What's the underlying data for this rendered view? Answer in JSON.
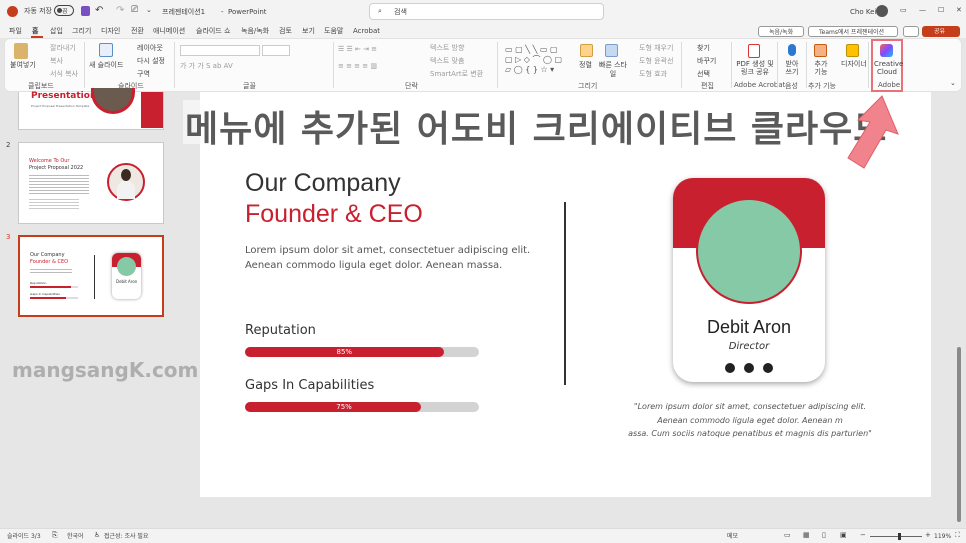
{
  "titlebar": {
    "autosave": "자동 저장",
    "toggle": "끔",
    "doc_title": "프레젠테이션1",
    "app": "PowerPoint",
    "search": "검색",
    "user": "Cho Kei"
  },
  "menu": {
    "tabs": [
      "파일",
      "홈",
      "삽입",
      "그리기",
      "디자인",
      "전환",
      "애니메이션",
      "슬라이드 쇼",
      "녹음/녹화",
      "검토",
      "보기",
      "도움말",
      "Acrobat"
    ],
    "active": "홈"
  },
  "top_right": {
    "record": "녹음/녹화",
    "teams": "Teams에서 프레젠테이션",
    "share": "공유"
  },
  "ribbon": {
    "clipboard": {
      "paste": "붙여넣기",
      "cut": "잘라내기",
      "copy": "복사",
      "format": "서식 복사",
      "label": "클립보드"
    },
    "slides": {
      "new": "새 슬라이드",
      "layout": "레이아웃",
      "reset": "다시 설정",
      "section": "구역",
      "label": "슬라이드"
    },
    "font": {
      "label": "글꼴"
    },
    "paragraph": {
      "text_dir": "텍스트 방향",
      "align": "텍스트 맞춤",
      "smartart": "SmartArt로 변환",
      "label": "단락"
    },
    "drawing": {
      "arrange": "정렬",
      "styles": "빠른 스타일",
      "fill": "도형 채우기",
      "outline": "도형 윤곽선",
      "effects": "도형 효과",
      "label": "그리기"
    },
    "editing": {
      "find": "찾기",
      "replace": "바꾸기",
      "select": "선택",
      "label": "편집"
    },
    "acrobat": {
      "pdf": "PDF 생성 및 링크 공유",
      "label": "Adobe Acrobat"
    },
    "voice": {
      "dictate": "받아쓰기",
      "label": "음성"
    },
    "addins": {
      "addins": "추가 기능",
      "label": "추가 기능"
    },
    "designer": {
      "label": "디자이너"
    },
    "adobe": {
      "cc": "Creative Cloud",
      "label": "Adobe"
    }
  },
  "overlay": {
    "heading": "메뉴에 추가된 어도비 크리에이티브 클라우드",
    "watermark": "mangsangK.com"
  },
  "thumbnails": [
    {
      "num": "",
      "title": "Presentation",
      "sub": "Project Proposal Presentation Template"
    },
    {
      "num": "2",
      "title": "Welcome To Our",
      "title2": "Project Proposal 2022"
    },
    {
      "num": "3",
      "title": "Our Company",
      "title2": "Founder & CEO",
      "card": "Debit Aron",
      "r": "Reputation",
      "g": "Gaps In Capabilities"
    }
  ],
  "slide": {
    "title1": "Our Company",
    "title2": "Founder & CEO",
    "desc1": "Lorem ipsum dolor sit amet, consectetuer adipiscing elit.",
    "desc2": "Aenean commodo ligula eget dolor. Aenean massa.",
    "skills": [
      {
        "label": "Reputation",
        "value": 85,
        "text": "85%"
      },
      {
        "label": "Gaps In Capabilities",
        "value": 75,
        "text": "75%"
      }
    ],
    "card": {
      "name": "Debit Aron",
      "role": "Director"
    },
    "quote1": "\"Lorem ipsum dolor sit amet, consectetuer adipiscing elit.",
    "quote2": "Aenean commodo ligula eget dolor. Aenean m",
    "quote3": "assa. Cum sociis natoque penatibus et magnis dis parturien\""
  },
  "status": {
    "slide": "슬라이드 3/3",
    "lang": "한국어",
    "access": "접근성: 조사 필요",
    "notes": "메모",
    "zoom": "119%"
  },
  "colors": {
    "accent": "#c8202f",
    "avatar": "#86c9a7",
    "ppt": "#c43e1c"
  }
}
